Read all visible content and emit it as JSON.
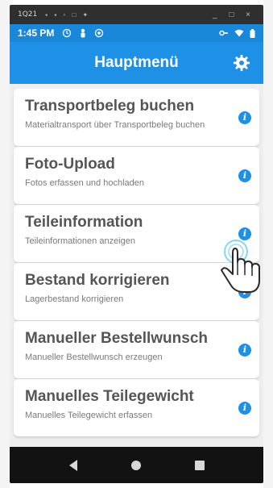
{
  "window_bar": {
    "title": "1Q21",
    "icons": "▪ ▪ ▫ □ ✦",
    "controls": "_ □ ×"
  },
  "status_bar": {
    "time": "1:45 PM",
    "left_icons": [
      "sync-icon",
      "person-icon",
      "camera-icon"
    ],
    "right_icons": [
      "key-icon",
      "wifi-icon",
      "battery-icon"
    ]
  },
  "app_bar": {
    "title": "Hauptmenü",
    "settings_icon": "gear-icon",
    "accent_color": "#1e90e6"
  },
  "menu": {
    "items": [
      {
        "title": "Transportbeleg buchen",
        "subtitle": "Materialtransport über Transportbeleg buchen"
      },
      {
        "title": "Foto-Upload",
        "subtitle": "Fotos erfassen und hochladen"
      },
      {
        "title": "Teileinformation",
        "subtitle": "Teileinformationen anzeigen"
      },
      {
        "title": "Bestand korrigieren",
        "subtitle": "Lagerbestand korrigieren"
      },
      {
        "title": "Manueller Bestellwunsch",
        "subtitle": "Manueller Bestellwunsch erzeugen"
      },
      {
        "title": "Manuelles Teilegewicht",
        "subtitle": "Manuelles Teilegewicht erfassen"
      }
    ],
    "info_glyph": "i"
  },
  "nav_bar": {
    "buttons": [
      "back-icon",
      "home-icon",
      "recents-icon"
    ]
  }
}
